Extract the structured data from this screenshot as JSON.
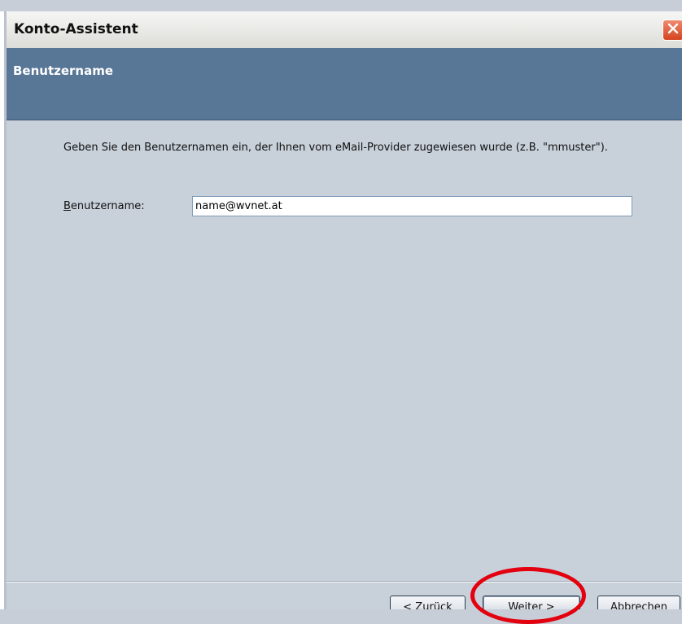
{
  "window": {
    "title": "Konto-Assistent",
    "close_icon": "close-icon",
    "close_color": "#d5441f"
  },
  "banner": {
    "title": "Benutzername",
    "color": "#587696"
  },
  "content": {
    "description": "Geben Sie den Benutzernamen ein, der Ihnen vom eMail-Provider zugewiesen wurde (z.B. \"mmuster\").",
    "username_label_accel": "B",
    "username_label_rest": "enutzername:",
    "username_value": "name@wvnet.at"
  },
  "buttons": {
    "back": "< Zurück",
    "next": "Weiter >",
    "cancel": "Abbrechen"
  },
  "annotation": {
    "ring_color": "#e3000f",
    "highlights": "next-button"
  }
}
